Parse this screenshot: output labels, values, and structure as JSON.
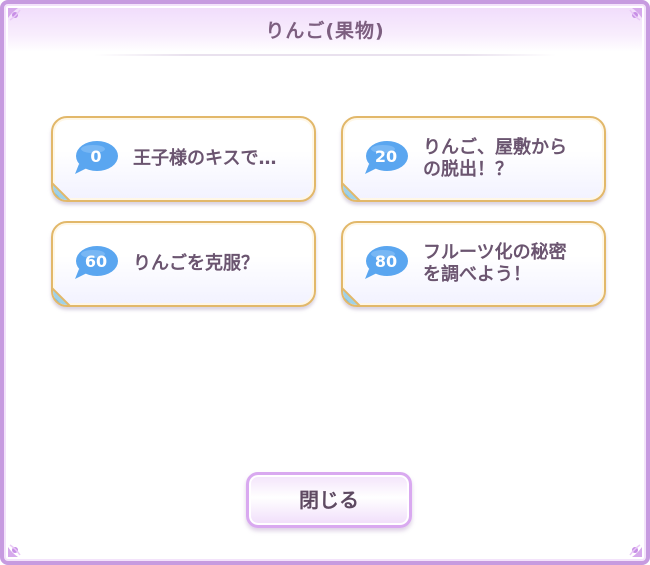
{
  "dialog": {
    "title": "りんご(果物)"
  },
  "episodes": [
    {
      "number": "0",
      "label": "王子様のキスで…"
    },
    {
      "number": "20",
      "label": "りんご、屋敷から\nの脱出！？"
    },
    {
      "number": "60",
      "label": "りんごを克服？"
    },
    {
      "number": "80",
      "label": "フルーツ化の秘密\nを調べよう！"
    }
  ],
  "close_button": {
    "label": "閉じる"
  },
  "colors": {
    "frame": "#c79be0",
    "card_border": "#e2b86a",
    "bubble": "#5aa6f0",
    "text": "#6b5570"
  }
}
